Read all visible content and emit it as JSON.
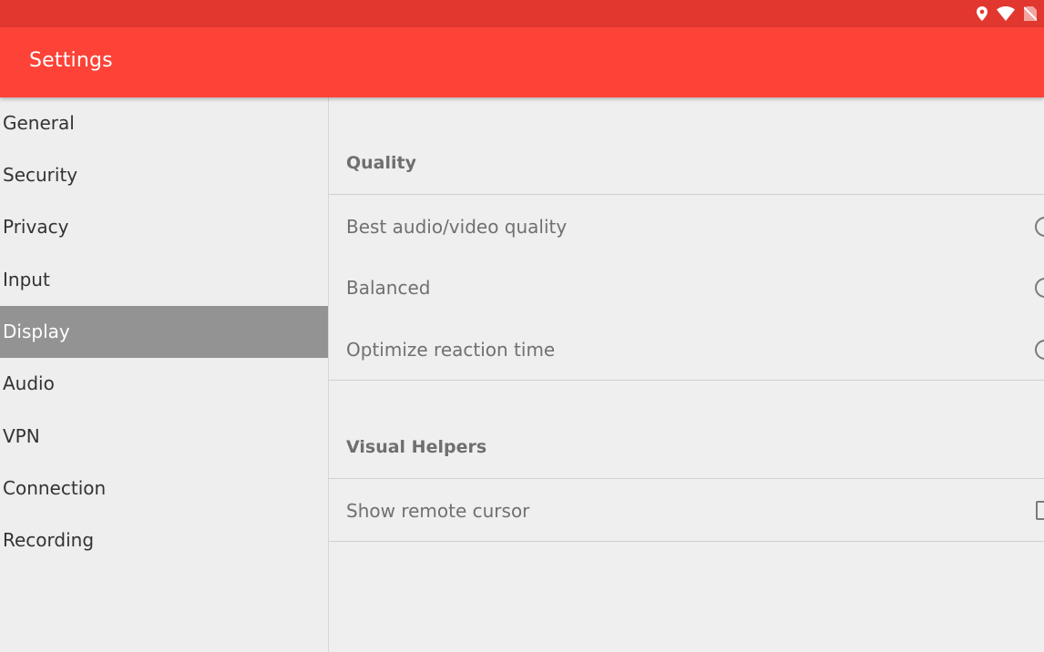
{
  "status_bar": {
    "icons": [
      "location-icon",
      "wifi-icon",
      "no-sim-icon"
    ],
    "color": "#e2372e"
  },
  "app_bar": {
    "title": "Settings",
    "color": "#fd4237"
  },
  "sidebar": {
    "items": [
      {
        "label": "General",
        "active": false
      },
      {
        "label": "Security",
        "active": false
      },
      {
        "label": "Privacy",
        "active": false
      },
      {
        "label": "Input",
        "active": false
      },
      {
        "label": "Display",
        "active": true
      },
      {
        "label": "Audio",
        "active": false
      },
      {
        "label": "VPN",
        "active": false
      },
      {
        "label": "Connection",
        "active": false
      },
      {
        "label": "Recording",
        "active": false
      }
    ],
    "active_color": "#939393"
  },
  "content": {
    "quality": {
      "header": "Quality",
      "options": [
        {
          "label": "Best audio/video quality",
          "control": "radio"
        },
        {
          "label": "Balanced",
          "control": "radio"
        },
        {
          "label": "Optimize reaction time",
          "control": "radio"
        }
      ]
    },
    "visual_helpers": {
      "header": "Visual Helpers",
      "options": [
        {
          "label": "Show remote cursor",
          "control": "checkbox"
        }
      ]
    }
  }
}
